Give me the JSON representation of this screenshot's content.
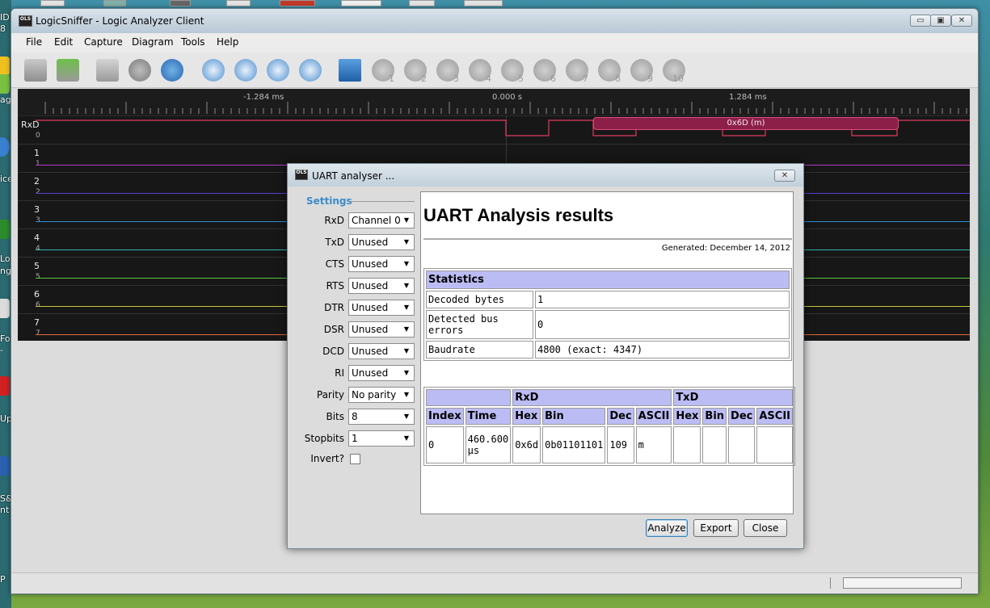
{
  "desktop": {
    "fragments": [
      "ID",
      "8",
      "ag",
      "ice",
      "Lo",
      "ng",
      "For",
      "-",
      "Up",
      "S&",
      "nt",
      "P"
    ]
  },
  "window": {
    "title": "LogicSniffer - Logic Analyzer Client",
    "app_icon": "OLS",
    "controls": {
      "minimize": "▭",
      "maximize": "▣",
      "close": "✕"
    }
  },
  "menu": {
    "file": "File",
    "edit": "Edit",
    "capture": "Capture",
    "diagram": "Diagram",
    "tools": "Tools",
    "help": "Help"
  },
  "toolbar": {
    "icons": [
      "open-file-icon",
      "save-download-icon",
      "repeat-capture-icon",
      "cancel-icon",
      "refresh-icon",
      "zoom-in-icon",
      "zoom-out-icon",
      "zoom-original-icon",
      "zoom-all-icon",
      "home-icon"
    ],
    "markers": [
      "1",
      "2",
      "3",
      "4",
      "5",
      "6",
      "7",
      "8",
      "9",
      "10"
    ]
  },
  "signals": {
    "ruler": {
      "left": "-1.284 ms",
      "center": "0.000 s",
      "right": "1.284 ms"
    },
    "channels": [
      {
        "label": "RxD",
        "index": "0",
        "color": "#e03c5c"
      },
      {
        "label": "1",
        "index": "1",
        "color": "#b23cc8"
      },
      {
        "label": "2",
        "index": "2",
        "color": "#5a3cd0"
      },
      {
        "label": "3",
        "index": "3",
        "color": "#2f8fd6"
      },
      {
        "label": "4",
        "index": "4",
        "color": "#2fb8b0"
      },
      {
        "label": "5",
        "index": "5",
        "color": "#5cc83c"
      },
      {
        "label": "6",
        "index": "6",
        "color": "#c8c83c"
      },
      {
        "label": "7",
        "index": "7",
        "color": "#e06a3c"
      }
    ],
    "annotation": "0x6D (m)"
  },
  "dialog": {
    "title": "UART analyser ...",
    "icon": "OLS",
    "close": "✕",
    "settings_label": "Settings",
    "settings": [
      {
        "label": "RxD",
        "value": "Channel 0"
      },
      {
        "label": "TxD",
        "value": "Unused"
      },
      {
        "label": "CTS",
        "value": "Unused"
      },
      {
        "label": "RTS",
        "value": "Unused"
      },
      {
        "label": "DTR",
        "value": "Unused"
      },
      {
        "label": "DSR",
        "value": "Unused"
      },
      {
        "label": "DCD",
        "value": "Unused"
      },
      {
        "label": "RI",
        "value": "Unused"
      },
      {
        "label": "Parity",
        "value": "No parity"
      },
      {
        "label": "Bits",
        "value": "8"
      },
      {
        "label": "Stopbits",
        "value": "1"
      }
    ],
    "invert_label": "Invert?",
    "results": {
      "title": "UART Analysis results",
      "generated": "Generated: December 14, 2012",
      "statistics": {
        "header": "Statistics",
        "rows": [
          {
            "label": "Decoded bytes",
            "value": "1"
          },
          {
            "label": "Detected bus errors",
            "value": "0"
          },
          {
            "label": "Baudrate",
            "value": "4800 (exact: 4347)"
          }
        ]
      },
      "table": {
        "group_rxd": "RxD",
        "group_txd": "TxD",
        "columns": [
          "Index",
          "Time",
          "Hex",
          "Bin",
          "Dec",
          "ASCII",
          "Hex",
          "Bin",
          "Dec",
          "ASCII"
        ],
        "rows": [
          {
            "index": "0",
            "time": "460.600 µs",
            "rx_hex": "0x6d",
            "rx_bin": "0b01101101",
            "rx_dec": "109",
            "rx_ascii": "m",
            "tx_hex": "",
            "tx_bin": "",
            "tx_dec": "",
            "tx_ascii": ""
          }
        ]
      }
    },
    "buttons": {
      "analyze": "Analyze",
      "export": "Export",
      "close": "Close"
    }
  }
}
